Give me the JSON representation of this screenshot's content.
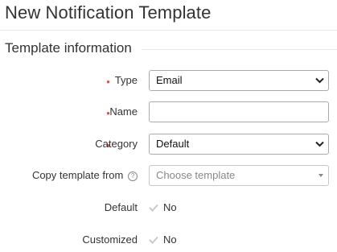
{
  "page": {
    "title": "New Notification Template"
  },
  "section": {
    "title": "Template information"
  },
  "form": {
    "type": {
      "label": "Type",
      "value": "Email"
    },
    "name": {
      "label": "Name",
      "value": ""
    },
    "category": {
      "label": "Category",
      "value": "Default"
    },
    "copy_from": {
      "label": "Copy template from",
      "placeholder": "Choose template",
      "help_icon": "?"
    },
    "default": {
      "label": "Default",
      "value": "No",
      "icon": "check-icon"
    },
    "customized": {
      "label": "Customized",
      "value": "No",
      "icon": "check-icon"
    }
  },
  "colors": {
    "required_marker": "#e74c3c",
    "check": "#c8c8c8"
  }
}
